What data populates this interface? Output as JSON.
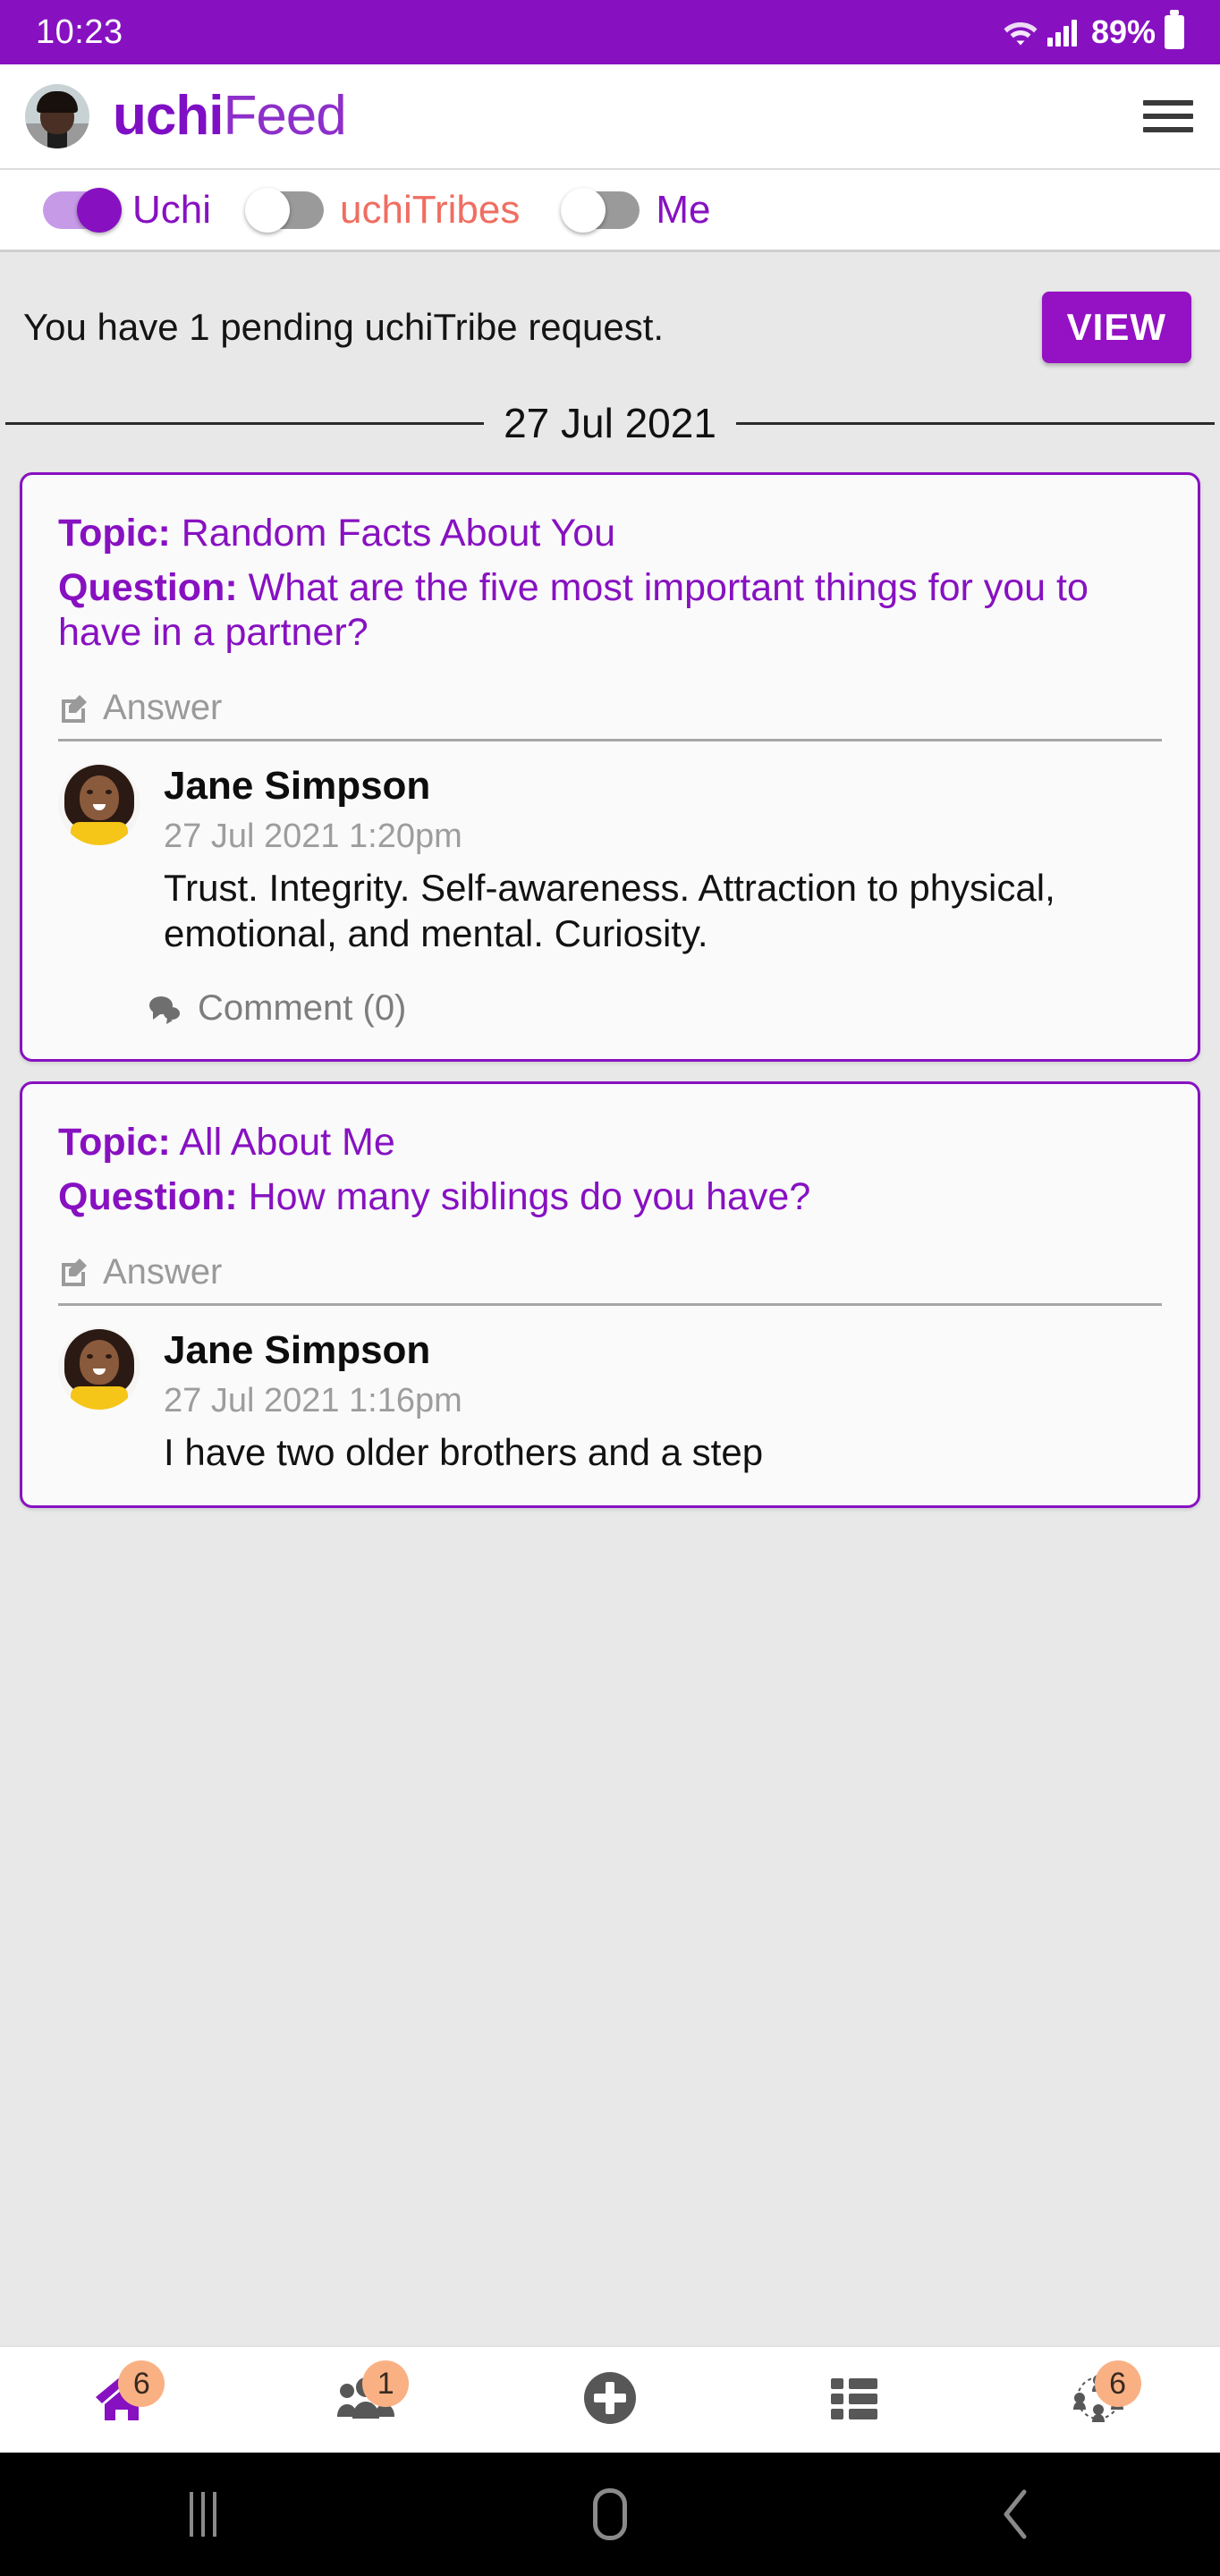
{
  "status_bar": {
    "time": "10:23",
    "battery_percent": "89%",
    "wifi_icon": "wifi-icon",
    "signal_icon": "signal-bars-icon",
    "battery_icon": "battery-icon",
    "background_color": "#8711c1"
  },
  "header": {
    "brand_first": "uchi",
    "brand_second": "Feed",
    "avatar_name": "profile-avatar",
    "menu_icon": "hamburger-menu-icon",
    "brand_color": "#8711c1"
  },
  "toggles": [
    {
      "label": "Uchi",
      "state": "on",
      "color": "#8711c1"
    },
    {
      "label": "uchiTribes",
      "state": "off",
      "color": "#ef6e61"
    },
    {
      "label": "Me",
      "state": "off",
      "color": "#8711c1"
    }
  ],
  "notice": {
    "text": "You have 1 pending uchiTribe request.",
    "button_label": "VIEW"
  },
  "date_divider": "27 Jul 2021",
  "cards": [
    {
      "topic_label": "Topic:",
      "topic_value": "Random Facts About You",
      "question_label": "Question:",
      "question_value": "What are the five most important things for you to have in a partner?",
      "answer_header": "Answer",
      "answer_icon": "edit-pencil-icon",
      "author": "Jane Simpson",
      "timestamp": "27 Jul 2021 1:20pm",
      "answer_text": "Trust. Integrity. Self-awareness. Attraction to physical, emotional, and mental. Curiosity.",
      "comment_label": "Comment (0)",
      "comment_icon": "comment-bubbles-icon"
    },
    {
      "topic_label": "Topic:",
      "topic_value": "All About Me",
      "question_label": "Question:",
      "question_value": "How many siblings do you have?",
      "answer_header": "Answer",
      "answer_icon": "edit-pencil-icon",
      "author": "Jane Simpson",
      "timestamp": "27 Jul 2021 1:16pm",
      "answer_text": "I have two older brothers and a step",
      "comment_label": "",
      "comment_icon": "comment-bubbles-icon"
    }
  ],
  "bottom_nav": [
    {
      "icon": "home-icon",
      "badge": "6",
      "active": true
    },
    {
      "icon": "people-group-icon",
      "badge": "1",
      "active": false
    },
    {
      "icon": "add-plus-icon",
      "badge": "",
      "active": false
    },
    {
      "icon": "list-view-icon",
      "badge": "",
      "active": false
    },
    {
      "icon": "tribe-network-icon",
      "badge": "6",
      "active": false
    }
  ],
  "android_nav": {
    "recents_icon": "recents-icon",
    "home_icon": "android-home-icon",
    "back_icon": "android-back-icon"
  }
}
